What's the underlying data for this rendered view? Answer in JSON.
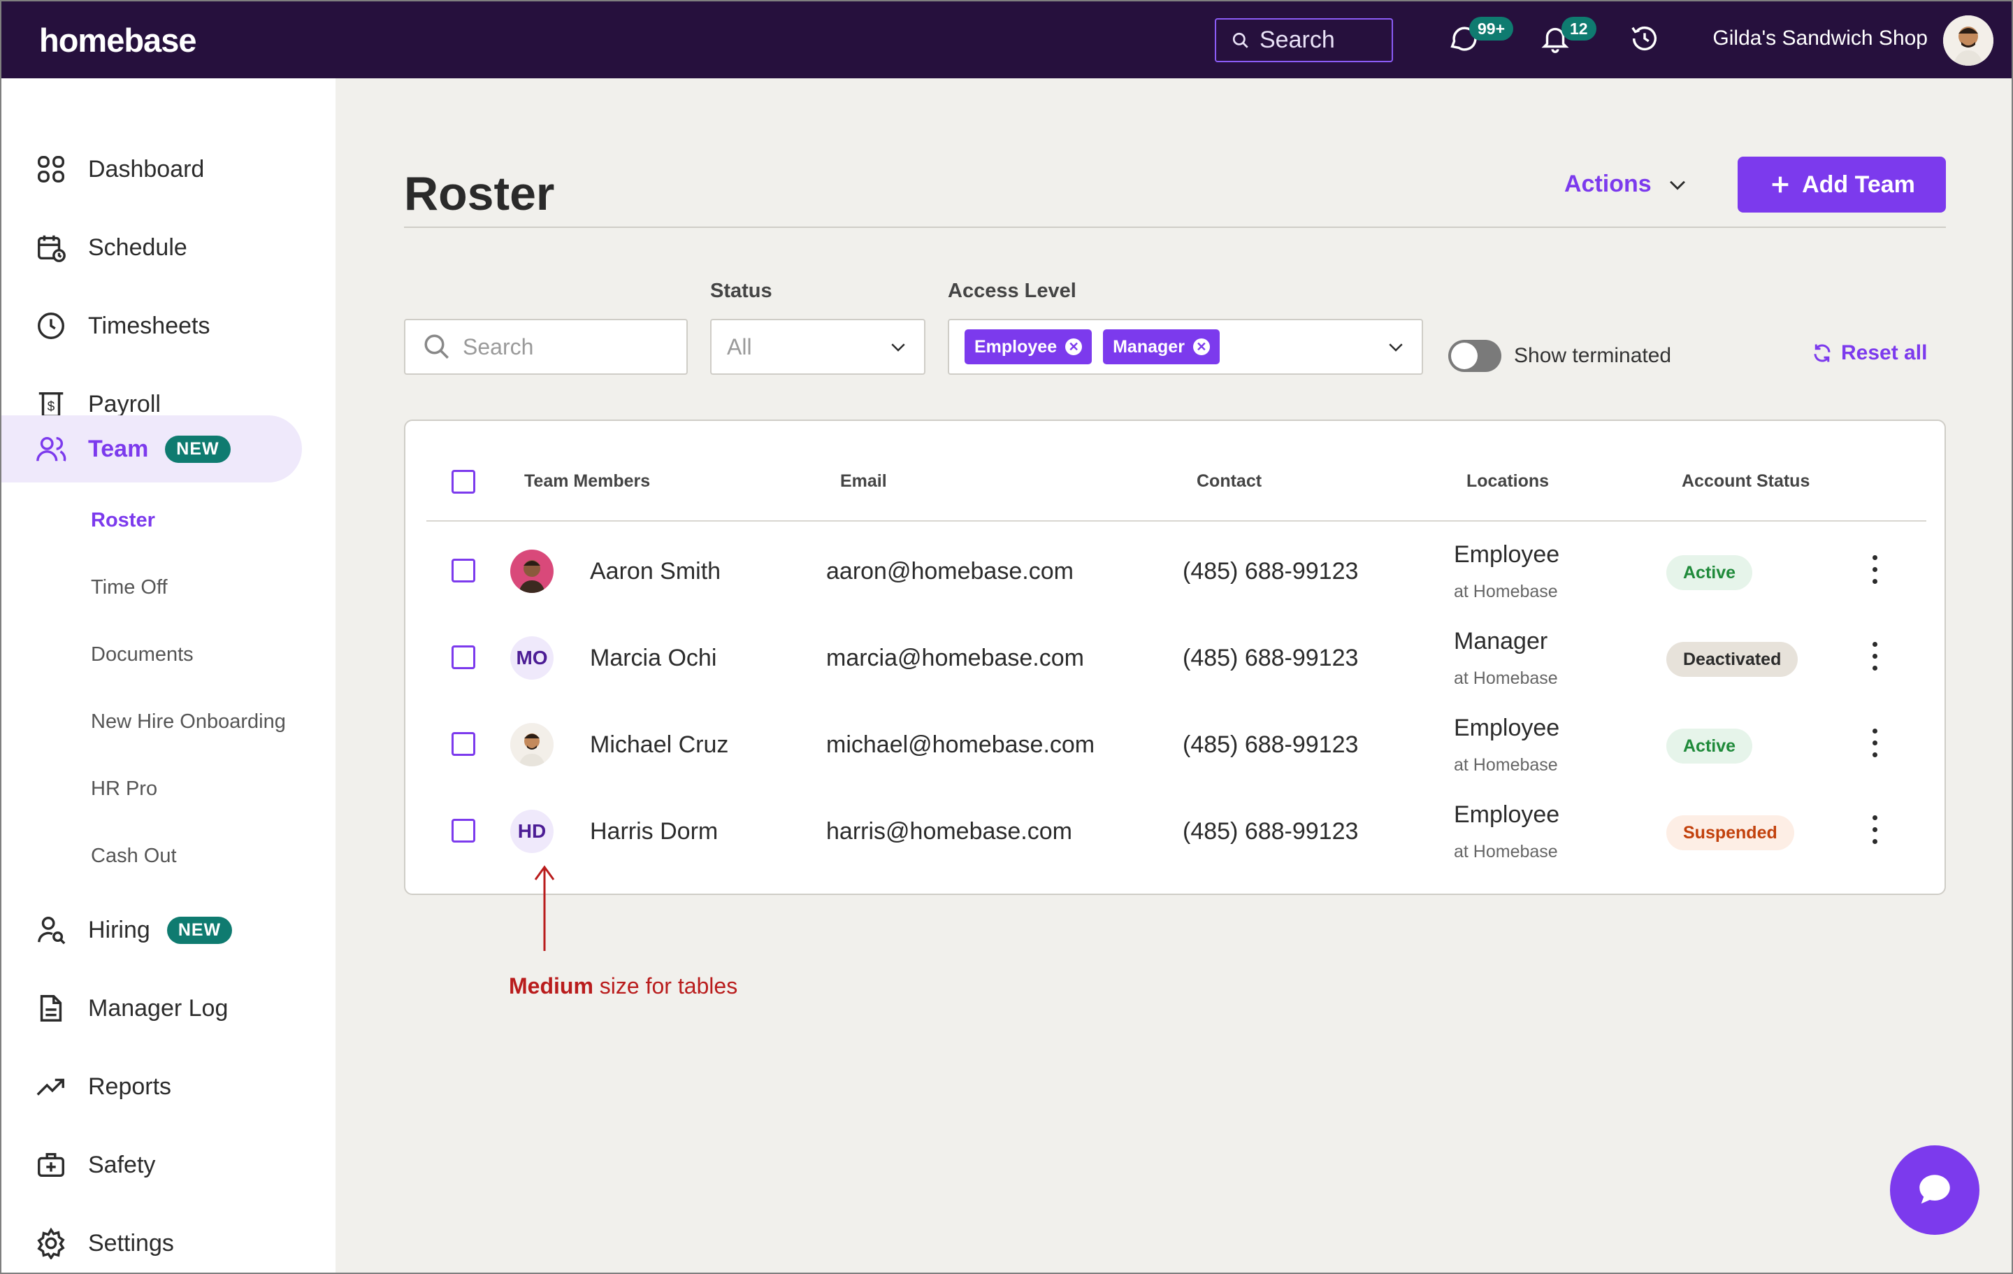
{
  "app": {
    "logo": "homebase",
    "shop_name": "Gilda's Sandwich Shop"
  },
  "topbar": {
    "search_placeholder": "Search",
    "messages_badge": "99+",
    "notifications_badge": "12"
  },
  "sidebar": {
    "items": [
      {
        "label": "Dashboard",
        "icon": "grid-icon"
      },
      {
        "label": "Schedule",
        "icon": "calendar-clock-icon"
      },
      {
        "label": "Timesheets",
        "icon": "clock-icon"
      },
      {
        "label": "Payroll",
        "icon": "payroll-icon"
      },
      {
        "label": "Team",
        "icon": "users-icon",
        "badge": "NEW",
        "active": true
      },
      {
        "label": "Hiring",
        "icon": "user-search-icon",
        "badge": "NEW"
      },
      {
        "label": "Manager Log",
        "icon": "document-icon"
      },
      {
        "label": "Reports",
        "icon": "trend-up-icon"
      },
      {
        "label": "Safety",
        "icon": "medkit-icon"
      },
      {
        "label": "Settings",
        "icon": "gear-icon"
      }
    ],
    "team_subitems": [
      "Roster",
      "Time Off",
      "Documents",
      "New Hire Onboarding",
      "HR Pro",
      "Cash Out"
    ]
  },
  "page": {
    "title": "Roster",
    "actions_label": "Actions",
    "add_team_label": "Add Team"
  },
  "filters": {
    "search_placeholder": "Search",
    "status_label": "Status",
    "status_value": "All",
    "access_label": "Access Level",
    "access_chips": [
      "Employee",
      "Manager"
    ],
    "show_terminated_label": "Show terminated",
    "show_terminated_on": false,
    "reset_label": "Reset all"
  },
  "table": {
    "columns": [
      "Team Members",
      "Email",
      "Contact",
      "Locations",
      "Account Status"
    ],
    "rows": [
      {
        "initials": "",
        "name": "Aaron Smith",
        "email": "aaron@homebase.com",
        "contact": "(485) 688-99123",
        "location": "Employee",
        "location_sub": "at Homebase",
        "status": "Active"
      },
      {
        "initials": "MO",
        "name": "Marcia Ochi",
        "email": "marcia@homebase.com",
        "contact": "(485) 688-99123",
        "location": "Manager",
        "location_sub": "at Homebase",
        "status": "Deactivated"
      },
      {
        "initials": "",
        "name": "Michael Cruz",
        "email": "michael@homebase.com",
        "contact": "(485) 688-99123",
        "location": "Employee",
        "location_sub": "at Homebase",
        "status": "Active"
      },
      {
        "initials": "HD",
        "name": "Harris Dorm",
        "email": "harris@homebase.com",
        "contact": "(485) 688-99123",
        "location": "Employee",
        "location_sub": "at Homebase",
        "status": "Suspended"
      }
    ]
  },
  "annotation": {
    "bold": "Medium",
    "rest": " size for tables"
  },
  "colors": {
    "brand_dark": "#26103d",
    "accent": "#7c3aed",
    "teal": "#0f7b70",
    "annotation": "#b91c1c"
  }
}
